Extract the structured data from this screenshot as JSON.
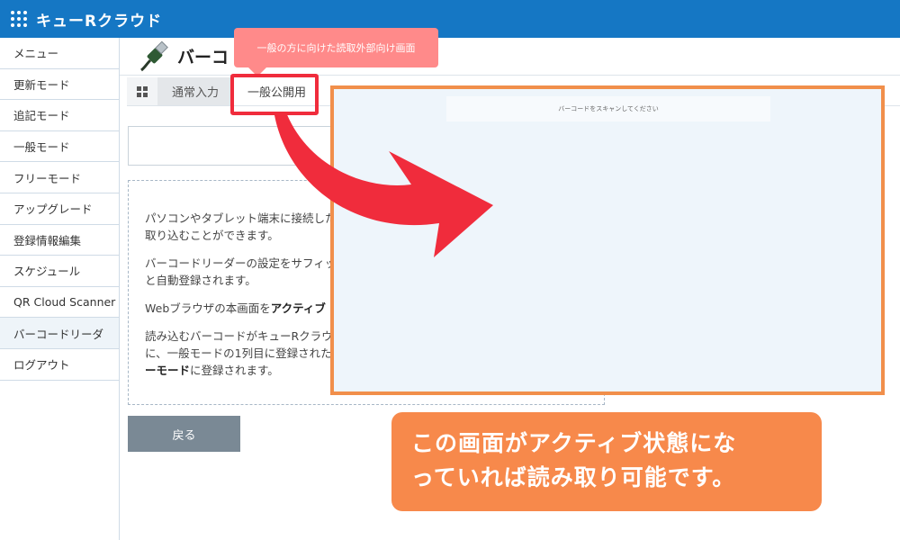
{
  "app": {
    "title": "キューRクラウド"
  },
  "sidebar": {
    "items": [
      {
        "label": "メニュー"
      },
      {
        "label": "更新モード"
      },
      {
        "label": "追記モード"
      },
      {
        "label": "一般モード"
      },
      {
        "label": "フリーモード"
      },
      {
        "label": "アップグレード"
      },
      {
        "label": "登録情報編集"
      },
      {
        "label": "スケジュール"
      },
      {
        "label": "QR Cloud Scanner"
      },
      {
        "label": "バーコードリーダ"
      },
      {
        "label": "ログアウト"
      }
    ],
    "active_index": 9
  },
  "page": {
    "title": "バーコ"
  },
  "tabs": [
    {
      "label": "通常入力"
    },
    {
      "label": "一般公開用"
    }
  ],
  "info": {
    "p1_line1": "パソコンやタブレット端末に接続した",
    "p1_line2": "取り込むことができます。",
    "p2_line1": "バーコードリーダーの設定をサフィッ",
    "p2_line2": "と自動登録されます。",
    "p3_prefix": "Webブラウザの本画面を",
    "p3_bold": "アクティブ",
    "p4_line1": "読み込むバーコードがキューRクラウ",
    "p4_line2": "に、一般モードの1列目に登録された",
    "p4_bold": "ーモード",
    "p4_suffix": "に登録されます。"
  },
  "buttons": {
    "back": "戻る"
  },
  "tooltip": {
    "text": "一般の方に向けた読取外部向け画面"
  },
  "preview": {
    "scan_prompt": "バーコードをスキャンしてください"
  },
  "callout": {
    "line1": "この画面がアクティブ状態にな",
    "line2": "っていれば読み取り可能です。"
  },
  "colors": {
    "header_blue": "#1577c4",
    "highlight_red": "#f02c3c",
    "tooltip_pink": "#ff8a8a",
    "callout_orange": "#f7894b",
    "preview_border": "#f18f4b"
  },
  "icons": [
    "grid-menu-icon",
    "usb-barcode-reader-icon",
    "grid-view-icon",
    "curved-arrow-icon"
  ]
}
